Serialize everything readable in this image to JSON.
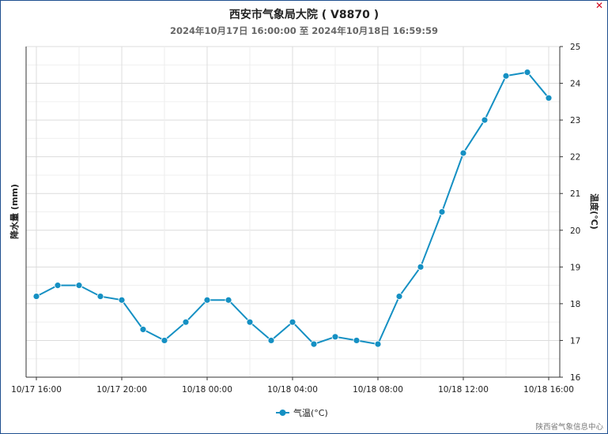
{
  "window": {
    "close_icon": "close-icon",
    "close_glyph": "✕"
  },
  "footer": {
    "credit": "陕西省气象信息中心"
  },
  "chart_data": {
    "type": "line",
    "title": "西安市气象局大院 ( V8870 )",
    "subtitle": "2024年10月17日 16:00:00 至 2024年10月18日 16:59:59",
    "left_axis_label": "降水量 (mm)",
    "right_axis_label": "温度(°C)",
    "x_tick_labels": [
      "10/17 16:00",
      "10/17 20:00",
      "10/18 00:00",
      "10/18 04:00",
      "10/18 08:00",
      "10/18 12:00",
      "10/18 16:00"
    ],
    "x": [
      "10/17 16:00",
      "10/17 17:00",
      "10/17 18:00",
      "10/17 19:00",
      "10/17 20:00",
      "10/17 21:00",
      "10/17 22:00",
      "10/17 23:00",
      "10/18 00:00",
      "10/18 01:00",
      "10/18 02:00",
      "10/18 03:00",
      "10/18 04:00",
      "10/18 05:00",
      "10/18 06:00",
      "10/18 07:00",
      "10/18 08:00",
      "10/18 09:00",
      "10/18 10:00",
      "10/18 11:00",
      "10/18 12:00",
      "10/18 13:00",
      "10/18 14:00",
      "10/18 15:00",
      "10/18 16:00"
    ],
    "series": [
      {
        "name": "气温(°C)",
        "color": "#1590c3",
        "axis": "right",
        "values": [
          18.2,
          18.5,
          18.5,
          18.2,
          18.1,
          17.3,
          17.0,
          17.5,
          18.1,
          18.1,
          17.5,
          17.0,
          17.5,
          16.9,
          17.1,
          17.0,
          16.9,
          18.2,
          19.0,
          20.5,
          22.1,
          23.0,
          24.2,
          24.3,
          23.6
        ]
      }
    ],
    "right_ylim": [
      16,
      25
    ],
    "right_y_ticks": [
      "16",
      "17",
      "18",
      "19",
      "20",
      "21",
      "22",
      "23",
      "24",
      "25"
    ],
    "grid": true,
    "legend_position": "bottom-center"
  }
}
